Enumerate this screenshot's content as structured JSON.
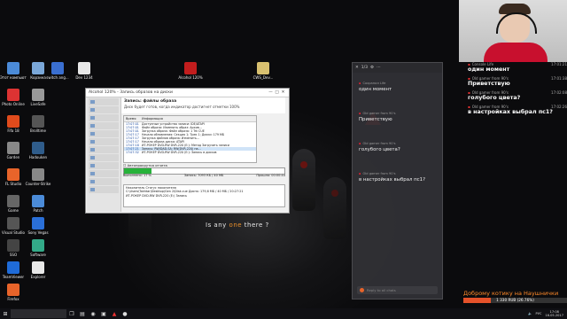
{
  "desktop": {
    "icons": [
      {
        "label": "Этот компьютер",
        "color": "#4b8bd8"
      },
      {
        "label": "Корзина",
        "color": "#7aa7d8"
      },
      {
        "label": "switch ang...",
        "color": "#3a6fd0"
      },
      {
        "label": "Dev 1234",
        "color": "#e8e8e8"
      },
      {
        "label": "Alcohol 120%",
        "color": "#c21d1d"
      },
      {
        "label": "CWS_Dev...",
        "color": "#d8c070"
      },
      {
        "label": "Photo Online",
        "color": "#d33"
      },
      {
        "label": "LiveSafe",
        "color": "#999"
      },
      {
        "label": "Fifa 18",
        "color": "#e04b1c"
      },
      {
        "label": "Brolltime",
        "color": "#555"
      },
      {
        "label": "Garden",
        "color": "#888"
      },
      {
        "label": "Hadouken",
        "color": "#2f5c8a"
      },
      {
        "label": "FL Studio",
        "color": "#e8642a"
      },
      {
        "label": "Counter-Strike",
        "color": "#888"
      },
      {
        "label": "Game",
        "color": "#666"
      },
      {
        "label": "Patch",
        "color": "#4b8bd8"
      },
      {
        "label": "Visual Studio",
        "color": "#555"
      },
      {
        "label": "Sony Vegas",
        "color": "#2a6fd8"
      },
      {
        "label": "SSO",
        "color": "#444"
      },
      {
        "label": "Software",
        "color": "#3a8"
      },
      {
        "label": "TeamViewer",
        "color": "#1f6bd8"
      },
      {
        "label": "Explorer",
        "color": "#e8e8e8"
      },
      {
        "label": "Firefox",
        "color": "#e8642a"
      }
    ],
    "center_text_before": "Is any",
    "center_text_o": "one",
    "center_text_after": " there ?"
  },
  "alcohol": {
    "title": "Alcohol 120% - Запись образов на диски",
    "header_title": "Запись: файлы образа",
    "header_sub": "Диск будет готов, когда индикатор достигнет отметки 100%",
    "log_columns": [
      "Время",
      "Информация"
    ],
    "log_rows": [
      {
        "time": "17:07:01",
        "text": "Доступные устройства записи: IDE/ATAPI"
      },
      {
        "time": "17:07:01",
        "text": "Файл образа: Изменить образ: Архив..."
      },
      {
        "time": "17:07:01",
        "text": "Загрузка образа: Файл образа: 1 Trk CUE"
      },
      {
        "time": "17:07:17",
        "text": "Начало обновления: Секция 1; Трек 1; Диски: 179 МБ"
      },
      {
        "time": "17:07:17",
        "text": "Загрузка файлов образа: Изменить..."
      },
      {
        "time": "17:07:17",
        "text": "Начало образа диска: ATAPI"
      },
      {
        "time": "17:07:18",
        "text": "ИТ-РОКЕР DVD-RW DVR-220 (E:): Метод Загрузить записи"
      },
      {
        "time": "17:07:21",
        "text": "Запись: RW/DAD-SA; RW(DVR-220) на..."
      },
      {
        "time": "17:07:32",
        "text": "ИТ-РОКЕР DVD-RW DVR-220 (E:): Запись в дисков"
      }
    ],
    "checkbox_label": "Автопрокрутка отчета",
    "progress_pct": 0.17,
    "progress_left": "Выполнено: 17 %",
    "progress_mid": "Запись: 7093 КБ / 40 МБ",
    "progress_right": "Прошло: 00:00:44",
    "drive_label": "Используемый образ: ТЕКУ",
    "box_lines": [
      "Накопитель                     Статус накопителя",
      "C:\\Users\\Tokhtar\\Desktop\\Gen 2\\Disk.cue     Диспк: 179,6 МБ / 40 МБ / 20:27:21",
      "ИТ-РОКЕР DVD-RW DVR-220 (E:)   Запись"
    ],
    "window_buttons": [
      "—",
      "□",
      "✕"
    ]
  },
  "chat_overlay": {
    "title": "1/3",
    "messages": [
      {
        "user": "Сохранил Life",
        "time": "",
        "text": "один момент"
      },
      {
        "user": "Old gamer from 90's",
        "time": "",
        "text": "Приветствую"
      },
      {
        "user": "Old gamer from 90's",
        "time": "",
        "text": "голубого цвета?"
      },
      {
        "user": "Old gamer from 90's",
        "time": "",
        "text": "в настройках выбрал пс1?"
      }
    ],
    "input_placeholder": "Reply to all chats"
  },
  "right_chat": {
    "messages": [
      {
        "user": "Console Life",
        "time": "17:01:21",
        "text": "один момент"
      },
      {
        "user": "Old gamer from 90's",
        "time": "17:01:38",
        "text": "Приветствую"
      },
      {
        "user": "Old gamer from 90's",
        "time": "17:02:08",
        "text": "голубого цвета?"
      },
      {
        "user": "Old gamer from 90's",
        "time": "17:02:26",
        "text": "в настройках выбрал пс1?"
      }
    ]
  },
  "donation": {
    "title": "Доброму котику на Наушнички",
    "progress_text": "1 330 RUB (26.76%)",
    "progress_frac": 0.2676,
    "goal": "5 000"
  },
  "taskbar": {
    "search_placeholder": "",
    "lang": "РУС",
    "time": "17:08",
    "date": "16.05.2017"
  }
}
